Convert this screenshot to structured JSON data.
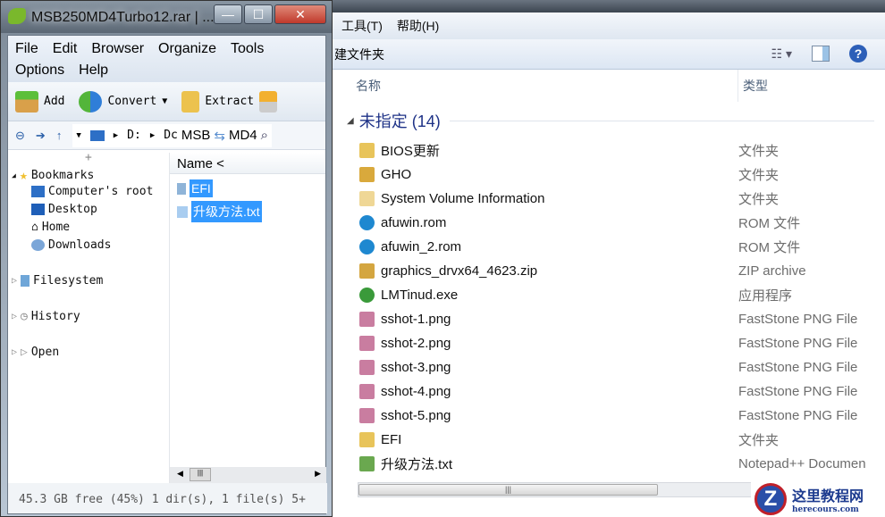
{
  "archiver": {
    "title": "MSB250MD4Turbo12.rar | ...",
    "menu_row1": [
      "File",
      "Edit",
      "Browser",
      "Organize",
      "Tools"
    ],
    "menu_row2": [
      "Options",
      "Help"
    ],
    "toolbar": {
      "add": "Add",
      "convert": "Convert",
      "extract": "Extract"
    },
    "address": {
      "drive": "D:",
      "path_fragment": "Dc",
      "search_left": "MSB",
      "search_right": "MD4"
    },
    "tree": {
      "bookmarks": "Bookmarks",
      "bookmark_items": [
        "Computer's root",
        "Desktop",
        "Home",
        "Downloads"
      ],
      "filesystem": "Filesystem",
      "history": "History",
      "open": "Open"
    },
    "file_list": {
      "header": "Name <",
      "items": [
        "EFI",
        "升级方法.txt"
      ]
    },
    "status": "45.3 GB free (45%)  1 dir(s), 1 file(s)  5+"
  },
  "explorer": {
    "menu": [
      "工具(T)",
      "帮助(H)"
    ],
    "toolbar_new_folder": "建文件夹",
    "columns": {
      "name": "名称",
      "type": "类型"
    },
    "group": "未指定 (14)",
    "files": [
      {
        "name": "BIOS更新",
        "type": "文件夹",
        "icon": "folder",
        "color": "#e8c45a"
      },
      {
        "name": "GHO",
        "type": "文件夹",
        "icon": "folder-special",
        "color": "#d9a93c"
      },
      {
        "name": "System Volume Information",
        "type": "文件夹",
        "icon": "folder",
        "color": "#efd796"
      },
      {
        "name": "afuwin.rom",
        "type": "ROM 文件",
        "icon": "rom",
        "color": "#1e88d0"
      },
      {
        "name": "afuwin_2.rom",
        "type": "ROM 文件",
        "icon": "rom",
        "color": "#1e88d0"
      },
      {
        "name": "graphics_drvx64_4623.zip",
        "type": "ZIP archive",
        "icon": "zip",
        "color": "#d4a640"
      },
      {
        "name": "LMTinud.exe",
        "type": "应用程序",
        "icon": "exe",
        "color": "#3a9a3a"
      },
      {
        "name": "sshot-1.png",
        "type": "FastStone PNG File",
        "icon": "png",
        "color": "#c97da0"
      },
      {
        "name": "sshot-2.png",
        "type": "FastStone PNG File",
        "icon": "png",
        "color": "#c97da0"
      },
      {
        "name": "sshot-3.png",
        "type": "FastStone PNG File",
        "icon": "png",
        "color": "#c97da0"
      },
      {
        "name": "sshot-4.png",
        "type": "FastStone PNG File",
        "icon": "png",
        "color": "#c97da0"
      },
      {
        "name": "sshot-5.png",
        "type": "FastStone PNG File",
        "icon": "png",
        "color": "#c97da0"
      },
      {
        "name": "EFI",
        "type": "文件夹",
        "icon": "folder",
        "color": "#e8c45a"
      },
      {
        "name": "升级方法.txt",
        "type": "Notepad++ Documen",
        "icon": "txt",
        "color": "#6aa84f"
      }
    ]
  },
  "watermark": {
    "cn": "这里教程网",
    "en": "herecours.com"
  }
}
